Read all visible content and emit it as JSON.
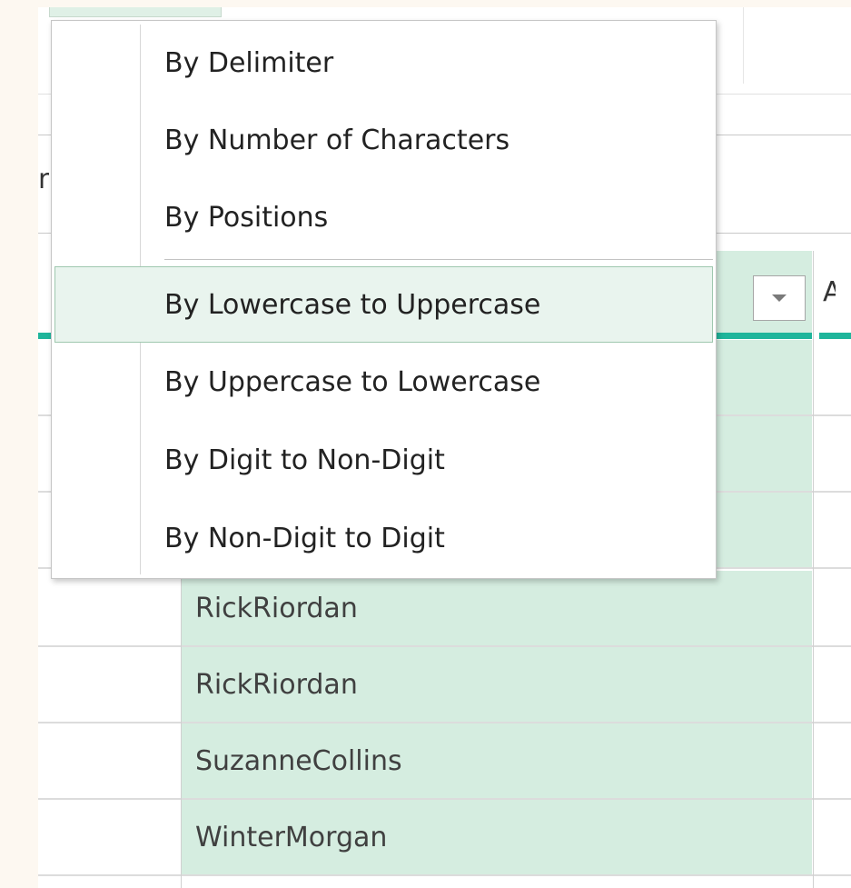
{
  "split_menu": {
    "items": [
      {
        "label": "By Delimiter"
      },
      {
        "label": "By Number of Characters"
      },
      {
        "label": "By Positions"
      },
      {
        "label": "By Lowercase to Uppercase"
      },
      {
        "label": "By Uppercase to Lowercase"
      },
      {
        "label": "By Digit to Non-Digit"
      },
      {
        "label": "By Non-Digit to Digit"
      }
    ],
    "highlighted_item": "By Lowercase to Uppercase"
  },
  "background": {
    "clipped_text": "n",
    "next_column_header_partial": "A"
  },
  "table": {
    "rows": [
      {
        "value": "RickRiordan"
      },
      {
        "value": "RickRiordan"
      },
      {
        "value": "SuzanneCollins"
      },
      {
        "value": "WinterMorgan"
      }
    ]
  },
  "colors": {
    "selected_column": "#d5ede0",
    "accent": "#1fb59b",
    "menu_hover": "#e9f4ee"
  }
}
